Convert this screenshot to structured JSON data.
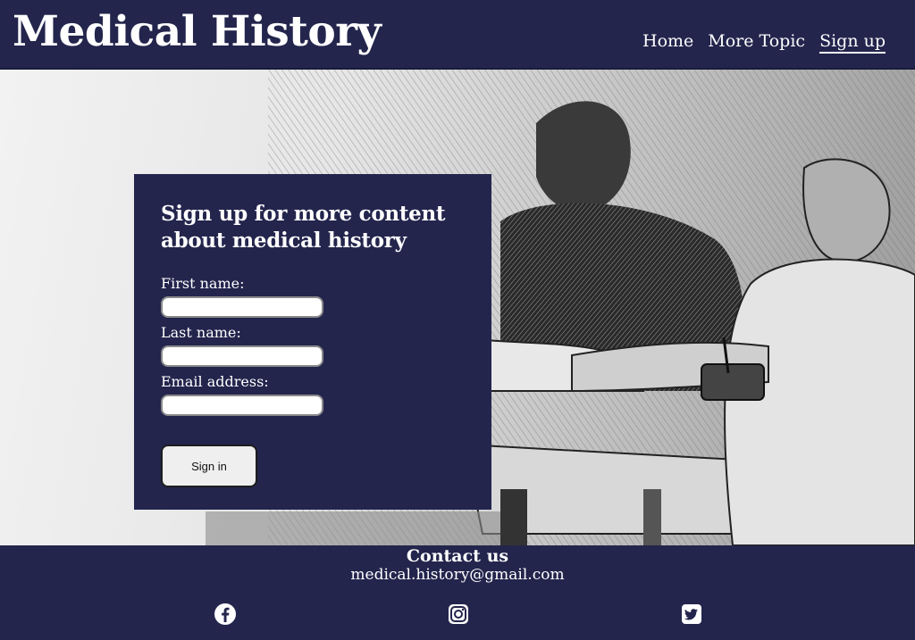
{
  "header": {
    "title": "Medical History",
    "nav": [
      {
        "label": "Home"
      },
      {
        "label": "More Topic"
      },
      {
        "label": "Sign up",
        "active": true
      }
    ]
  },
  "signup": {
    "heading": "Sign up for more content about medical history",
    "fields": [
      {
        "label": "First name:",
        "value": ""
      },
      {
        "label": "Last name:",
        "value": ""
      },
      {
        "label": "Email address:",
        "value": ""
      }
    ],
    "button_label": "Sign in"
  },
  "footer": {
    "contact_title": "Contact us",
    "email": "medical.history@gmail.com",
    "social_icons": [
      "facebook-icon",
      "instagram-icon",
      "twitter-icon"
    ]
  },
  "colors": {
    "navy": "#23254d",
    "white": "#ffffff",
    "button_bg": "#efefef"
  }
}
